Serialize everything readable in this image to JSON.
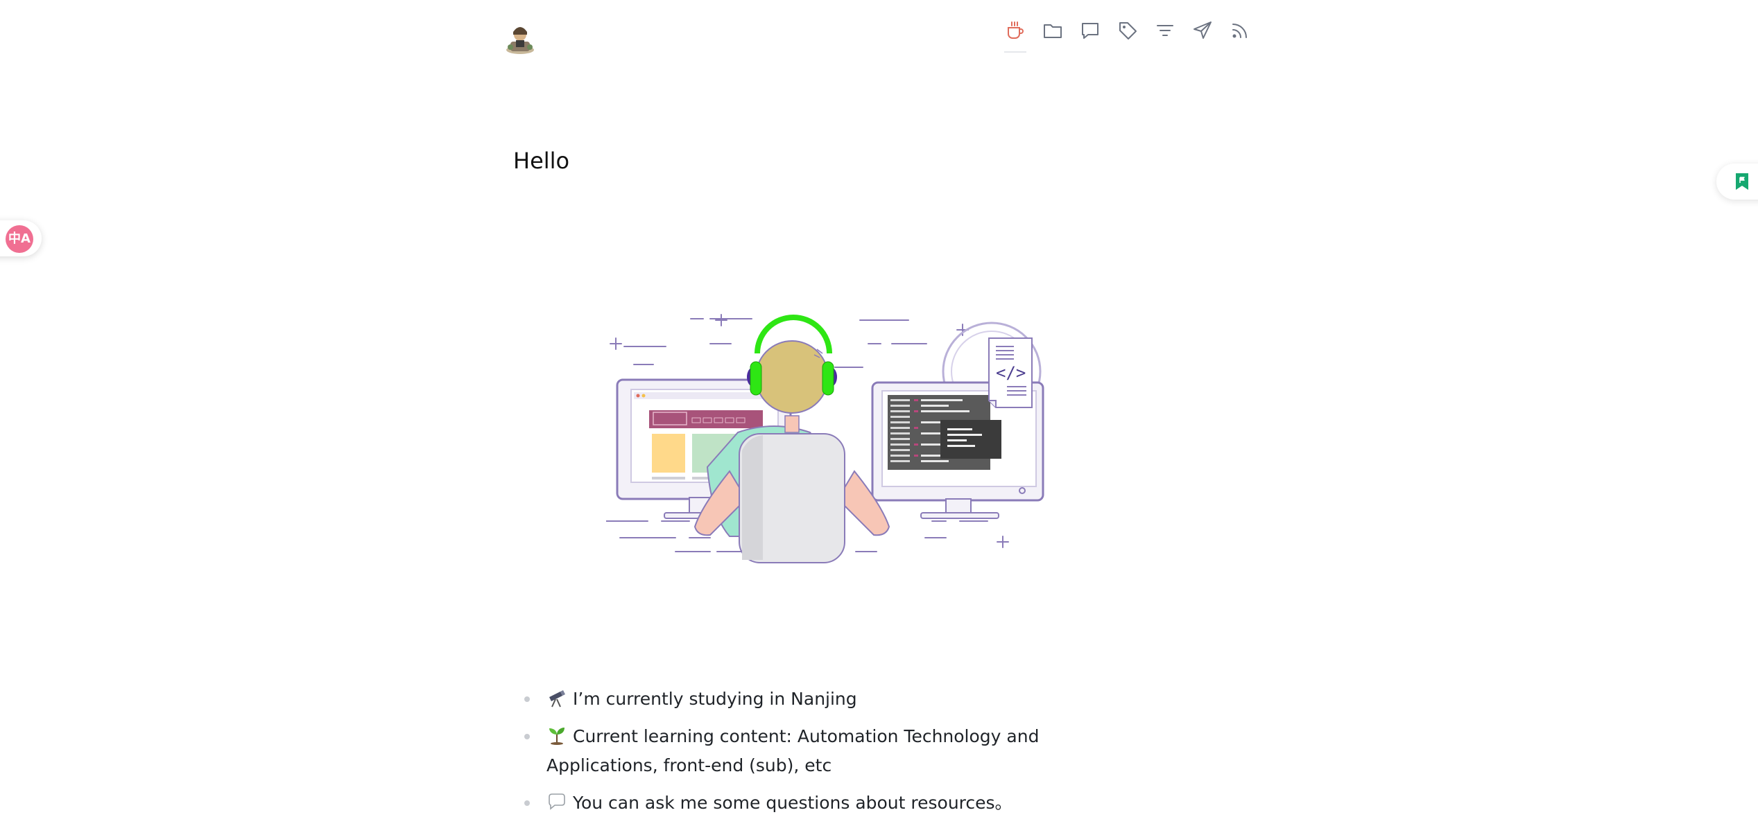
{
  "header": {
    "nav": [
      {
        "icon": "coffee-icon",
        "active": true
      },
      {
        "icon": "folder-icon"
      },
      {
        "icon": "comment-icon"
      },
      {
        "icon": "tag-icon"
      },
      {
        "icon": "filter-icon"
      },
      {
        "icon": "send-icon"
      },
      {
        "icon": "rss-icon"
      }
    ],
    "accent_color": "#e06c5b"
  },
  "main": {
    "title": "Hello",
    "items": [
      {
        "emoji": "telescope-icon",
        "text": "I’m currently studying in Nanjing"
      },
      {
        "emoji": "seedling-icon",
        "text": "Current learning content: Automation Technology and Applications, front-end (sub), etc"
      },
      {
        "emoji": "speech-bubble-icon",
        "text": "You can ask me some questions about resources。"
      }
    ]
  },
  "widgets": {
    "translate_label": "中A",
    "translate_color": "#f06f92",
    "bookmark_color": "#16a870"
  }
}
